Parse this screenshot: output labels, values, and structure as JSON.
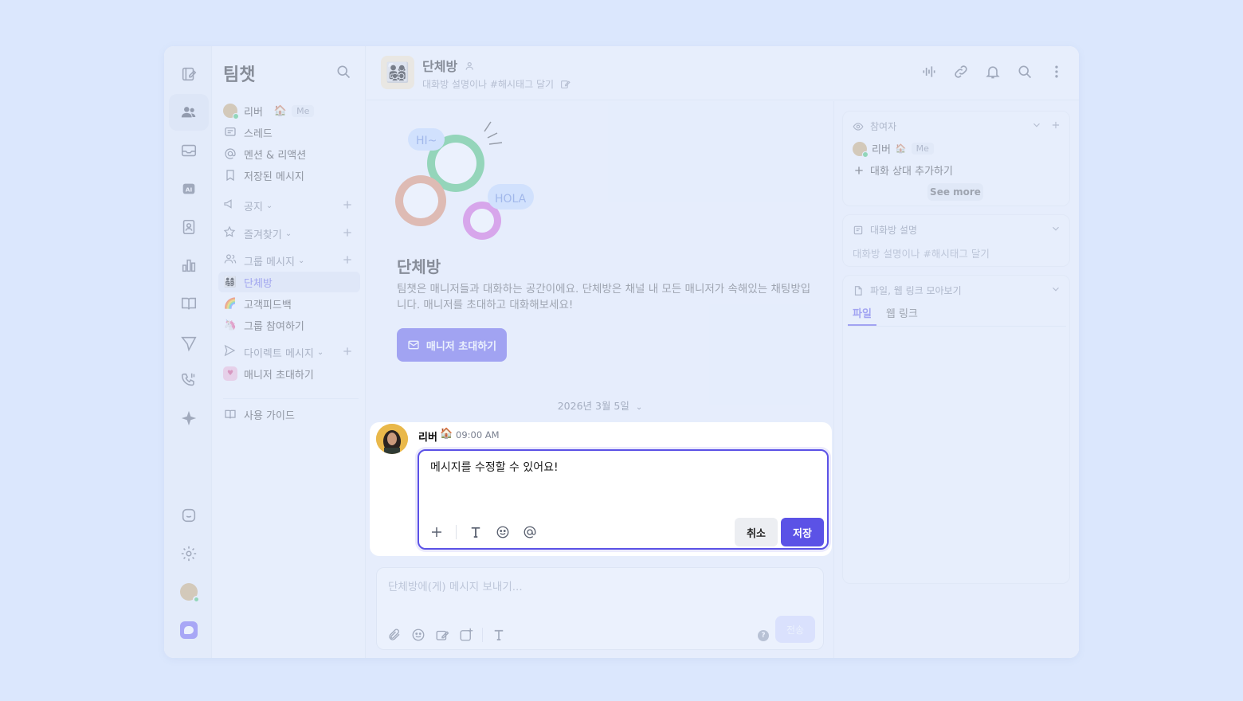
{
  "sidebar": {
    "title": "팀챗",
    "user": {
      "name": "리버",
      "emoji": "🏠",
      "me_badge": "Me"
    },
    "items": [
      {
        "label": "스레드"
      },
      {
        "label": "멘션 & 리액션"
      },
      {
        "label": "저장된 메시지"
      }
    ],
    "sections": {
      "notice": "공지",
      "favorites": "즐겨찾기",
      "group": "그룹 메시지",
      "direct": "다이렉트 메시지"
    },
    "group_items": [
      {
        "label": "단체방",
        "emoji": "👨‍👩‍👧‍👦"
      },
      {
        "label": "고객피드백",
        "emoji": "🌈"
      },
      {
        "label": "그룹 참여하기",
        "emoji": "🦄"
      }
    ],
    "direct_items": [
      {
        "label": "매니저 초대하기"
      }
    ],
    "guide": "사용 가이드"
  },
  "header": {
    "title": "단체방",
    "subtitle": "대화방 설명이나 #해시태그 달기",
    "emoji": "👨‍👩‍👧‍👦"
  },
  "hero": {
    "title": "단체방",
    "description": "팀챗은 매니저들과 대화하는 공간이에요. 단체방은 채널 내 모든 매니저가 속해있는 채팅방입니다. 매니저를 초대하고 대화해보세요!",
    "button": "매니저 초대하기",
    "bubble_hi": "HI~",
    "bubble_hola": "HOLA"
  },
  "date_divider": "2026년 3월 5일",
  "message": {
    "author": "리버",
    "author_emoji": "🏠",
    "time": "09:00 AM",
    "text": "메시지를 수정할 수 있어요!",
    "cancel": "취소",
    "save": "저장"
  },
  "composer": {
    "placeholder": "단체방에(게) 메시지 보내기...",
    "send": "전송",
    "help": "?"
  },
  "right_panel": {
    "participants": {
      "title": "참여자",
      "user": "리버",
      "user_emoji": "🏠",
      "me_badge": "Me",
      "add": "대화 상대 추가하기",
      "see_more": "See more"
    },
    "description": {
      "title": "대화방 설명",
      "placeholder": "대화방 설명이나 #해시태그 달기"
    },
    "files": {
      "title": "파일, 웹 링크 모아보기",
      "tabs": [
        "파일",
        "웹 링크"
      ]
    }
  },
  "colors": {
    "accent": "#5b52e6",
    "background": "#dbe7fd"
  }
}
